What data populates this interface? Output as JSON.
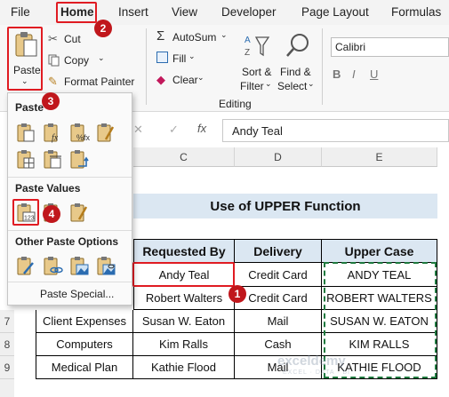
{
  "menu": {
    "file": "File",
    "home": "Home",
    "insert": "Insert",
    "view": "View",
    "developer": "Developer",
    "page_layout": "Page Layout",
    "formulas": "Formulas"
  },
  "ribbon": {
    "paste": "Paste",
    "cut": "Cut",
    "copy": "Copy",
    "format_painter": "Format Painter",
    "autosum": "AutoSum",
    "fill": "Fill",
    "clear": "Clear",
    "editing_group": "Editing",
    "sort_filter_line1": "Sort &",
    "sort_filter_line2": "Filter",
    "find_select_line1": "Find &",
    "find_select_line2": "Select",
    "font_name": "Calibri"
  },
  "formula_bar": {
    "fx": "fx",
    "value": "Andy Teal"
  },
  "paste_menu": {
    "paste_title": "Paste",
    "paste_values_title": "Paste Values",
    "other_title": "Other Paste Options",
    "paste_special": "Paste Special..."
  },
  "sheet": {
    "col_c": "C",
    "col_d": "D",
    "col_e": "E",
    "title": "Use of UPPER Function",
    "headers": [
      "Requested By",
      "Delivery",
      "Upper Case"
    ],
    "rows": [
      {
        "num": "",
        "b": "",
        "c": "Andy Teal",
        "d": "Credit Card",
        "e": "ANDY TEAL"
      },
      {
        "num": "",
        "b": "",
        "c": "Robert Walters",
        "d": "Credit Card",
        "e": "ROBERT WALTERS"
      },
      {
        "num": "7",
        "b": "Client Expenses",
        "c": "Susan W. Eaton",
        "d": "Mail",
        "e": "SUSAN W. EATON"
      },
      {
        "num": "8",
        "b": "Computers",
        "c": "Kim Ralls",
        "d": "Cash",
        "e": "KIM RALLS"
      },
      {
        "num": "9",
        "b": "Medical Plan",
        "c": "Kathie Flood",
        "d": "Mail",
        "e": "KATHIE FLOOD"
      }
    ]
  },
  "callouts": [
    "1",
    "2",
    "3",
    "4"
  ],
  "watermark": {
    "brand": "exceldemy",
    "tagline": "EXCEL · DATA · BI"
  },
  "colors": {
    "accent_red": "#e01b22",
    "callout_red": "#c0171c",
    "title_fill": "#dbe7f2",
    "copy_border": "#1f7a3f"
  }
}
